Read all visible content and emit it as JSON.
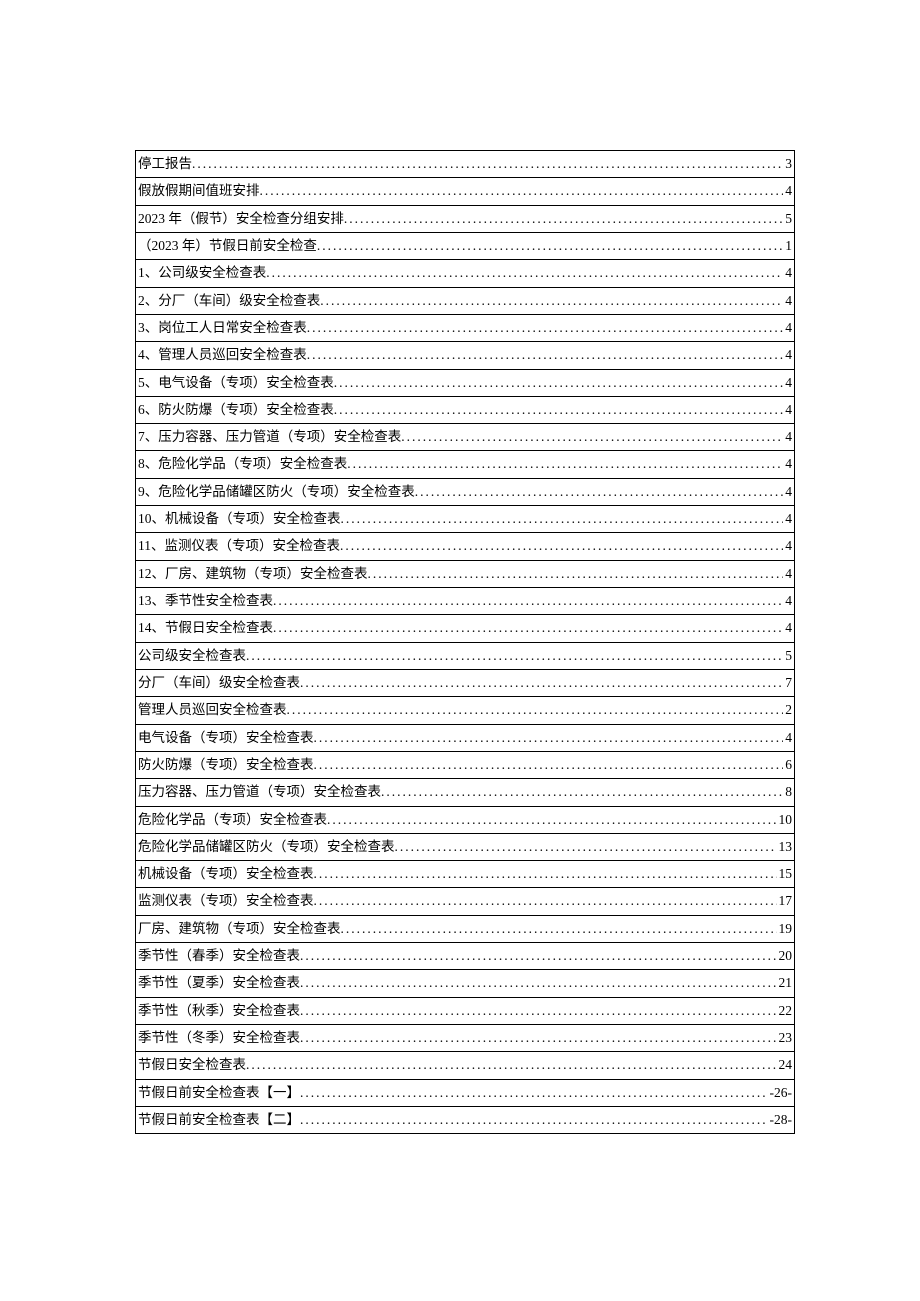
{
  "toc": [
    {
      "title": "停工报告",
      "page": "3"
    },
    {
      "title": "假放假期间值班安排",
      "page": "4"
    },
    {
      "title": "2023 年（假节）安全检查分组安排",
      "page": "5"
    },
    {
      "title": "（2023 年）节假日前安全检查",
      "page": "1"
    },
    {
      "title": "1、公司级安全检查表",
      "page": "4"
    },
    {
      "title": "2、分厂（车间）级安全检查表",
      "page": "4"
    },
    {
      "title": "3、岗位工人日常安全检查表",
      "page": "4"
    },
    {
      "title": "4、管理人员巡回安全检查表",
      "page": "4"
    },
    {
      "title": "5、电气设备（专项）安全检查表",
      "page": "4"
    },
    {
      "title": "6、防火防爆（专项）安全检查表",
      "page": "4"
    },
    {
      "title": "7、压力容器、压力管道（专项）安全检查表",
      "page": "4"
    },
    {
      "title": "8、危险化学品（专项）安全检查表",
      "page": "4"
    },
    {
      "title": "9、危险化学品储罐区防火（专项）安全检查表",
      "page": "4"
    },
    {
      "title": "10、机械设备（专项）安全检查表",
      "page": "4"
    },
    {
      "title": "11、监测仪表（专项）安全检查表",
      "page": "4"
    },
    {
      "title": "12、厂房、建筑物（专项）安全检查表",
      "page": "4"
    },
    {
      "title": "13、季节性安全检查表",
      "page": "4"
    },
    {
      "title": "14、节假日安全检查表",
      "page": "4"
    },
    {
      "title": "公司级安全检查表",
      "page": "5"
    },
    {
      "title": "分厂（车间）级安全检查表",
      "page": "7"
    },
    {
      "title": "管理人员巡回安全检查表",
      "page": "2"
    },
    {
      "title": "电气设备（专项）安全检查表",
      "page": "4"
    },
    {
      "title": "防火防爆（专项）安全检查表",
      "page": "6"
    },
    {
      "title": "压力容器、压力管道（专项）安全检查表",
      "page": "8"
    },
    {
      "title": "危险化学品（专项）安全检查表",
      "page": "10"
    },
    {
      "title": "危险化学品储罐区防火（专项）安全检查表",
      "page": "13"
    },
    {
      "title": "机械设备（专项）安全检查表",
      "page": "15"
    },
    {
      "title": "监测仪表（专项）安全检查表",
      "page": "17"
    },
    {
      "title": "厂房、建筑物（专项）安全检查表",
      "page": "19"
    },
    {
      "title": "季节性（春季）安全检查表",
      "page": "20"
    },
    {
      "title": "季节性（夏季）安全检查表",
      "page": "21"
    },
    {
      "title": "季节性（秋季）安全检查表",
      "page": "22"
    },
    {
      "title": "季节性（冬季）安全检查表",
      "page": "23"
    },
    {
      "title": "节假日安全检查表",
      "page": "24"
    },
    {
      "title": "节假日前安全检查表【一】",
      "page": "-26-"
    },
    {
      "title": "节假日前安全检查表【二】",
      "page": "-28-"
    }
  ]
}
